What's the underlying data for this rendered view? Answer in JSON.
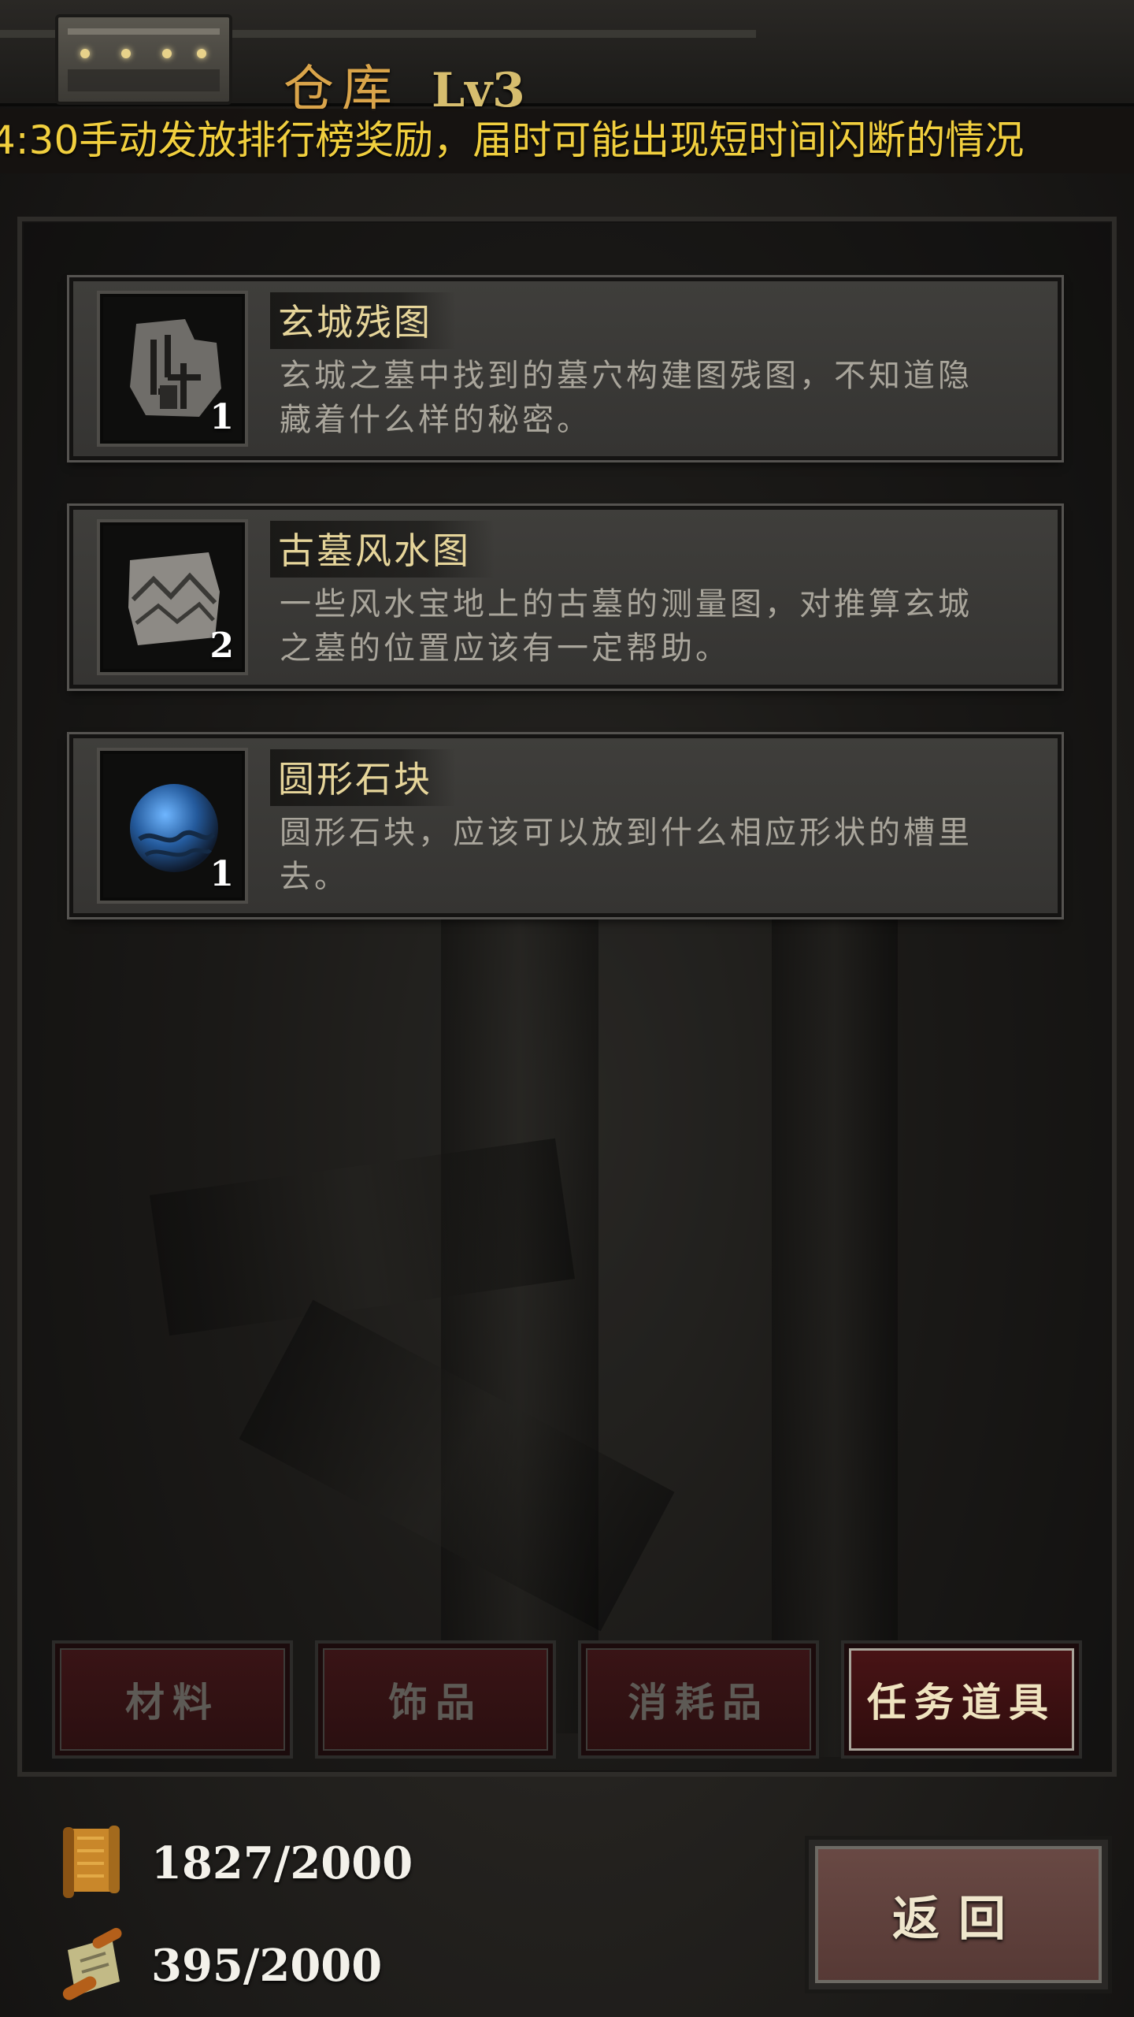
{
  "header": {
    "title": "仓库",
    "level": "Lv3"
  },
  "announcement": {
    "text": "4:30手动发放排行榜奖励，届时可能出现短时间闪断的情况"
  },
  "items": [
    {
      "name": "玄城残图",
      "desc": "玄城之墓中找到的墓穴构建图残图，不知道隐藏着什么样的秘密。",
      "count": "1",
      "icon": "map-fragment-icon"
    },
    {
      "name": "古墓风水图",
      "desc": "一些风水宝地上的古墓的测量图，对推算玄城之墓的位置应该有一定帮助。",
      "count": "2",
      "icon": "feng-shui-map-icon"
    },
    {
      "name": "圆形石块",
      "desc": "圆形石块，应该可以放到什么相应形状的槽里去。",
      "count": "1",
      "icon": "round-stone-icon"
    }
  ],
  "tabs": [
    {
      "label": "材料",
      "active": false
    },
    {
      "label": "饰品",
      "active": false
    },
    {
      "label": "消耗品",
      "active": false
    },
    {
      "label": "任务道具",
      "active": true
    }
  ],
  "resources": [
    {
      "icon": "scroll-icon",
      "value": "1827/2000"
    },
    {
      "icon": "rolled-map-icon",
      "value": "395/2000"
    }
  ],
  "buttons": {
    "back": "返回"
  },
  "colors": {
    "title": "#d9a44a",
    "announcement": "#f1cf3e",
    "item_name": "#e6d59a",
    "item_desc": "#a9a59b",
    "tab_active_text": "#efe3bf",
    "tab_bg": "#3a1416"
  }
}
